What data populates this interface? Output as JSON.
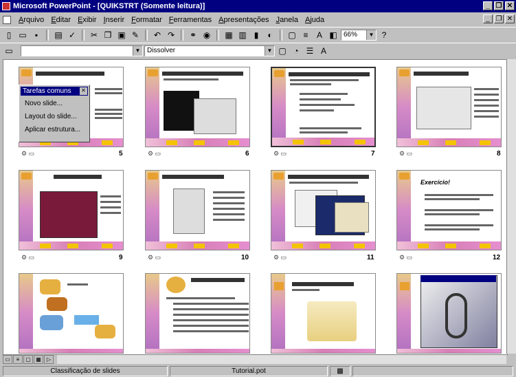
{
  "window": {
    "title": "Microsoft PowerPoint - [QUIKSTRT (Somente leitura)]",
    "controls": [
      "_",
      "❐",
      "✕"
    ]
  },
  "menu": [
    "Arquivo",
    "Editar",
    "Exibir",
    "Inserir",
    "Formatar",
    "Ferramentas",
    "Apresentações",
    "Janela",
    "Ajuda"
  ],
  "doc_controls": [
    "_",
    "❐",
    "✕"
  ],
  "toolbar": {
    "zoom": "66%",
    "transition": "Dissolver"
  },
  "popup": {
    "title": "Tarefas comuns",
    "items": [
      "Novo slide...",
      "Layout do slide...",
      "Aplicar estrutura..."
    ]
  },
  "slides": {
    "numbers": [
      "5",
      "6",
      "7",
      "8",
      "9",
      "10",
      "11",
      "12"
    ],
    "slide12_title": "Exercício!"
  },
  "status": {
    "view": "Classificação de slides",
    "file": "Tutorial.pot"
  }
}
